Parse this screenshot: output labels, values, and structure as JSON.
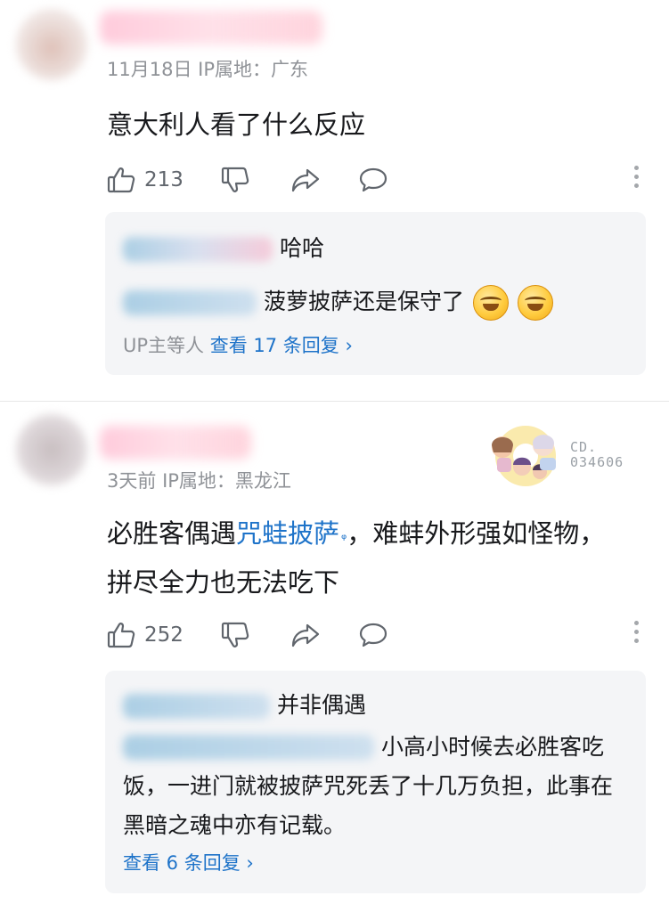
{
  "comments": [
    {
      "date": "11月18日",
      "ip_label": "IP属地：",
      "location": "广东",
      "content": "意大利人看了什么反应",
      "likes": "213",
      "replies": [
        {
          "text": "哈哈"
        },
        {
          "text": "菠萝披萨还是保守了"
        }
      ],
      "more_prefix": "UP主等人",
      "more_label": "查看 17 条回复",
      "more_chevron": "›"
    },
    {
      "date": "3天前",
      "ip_label": "IP属地：",
      "location": "黑龙江",
      "content_pre": "必胜客偶遇",
      "content_link": "咒蛙披萨",
      "content_link_icon": "ᵠ",
      "content_post": "，难蚌外形强如怪物，拼尽全力也无法吃下",
      "likes": "252",
      "decoration_number_line1": "CD.",
      "decoration_number_line2": "034606",
      "replies": [
        {
          "text": "并非偶遇"
        },
        {
          "text": "小高小时候去必胜客吃饭，一进门就被披萨咒死丢了十几万负担，此事在黑暗之魂中亦有记载。"
        }
      ],
      "more_label": "查看 6 条回复",
      "more_chevron": "›"
    }
  ],
  "icons": {
    "like": "thumbs-up-icon",
    "dislike": "thumbs-down-icon",
    "share": "share-icon",
    "reply": "comment-bubble-icon",
    "more": "more-vertical-icon"
  },
  "colors": {
    "link": "#1e73c9",
    "meta": "#8f9297",
    "reply_bg": "#f4f5f7"
  }
}
